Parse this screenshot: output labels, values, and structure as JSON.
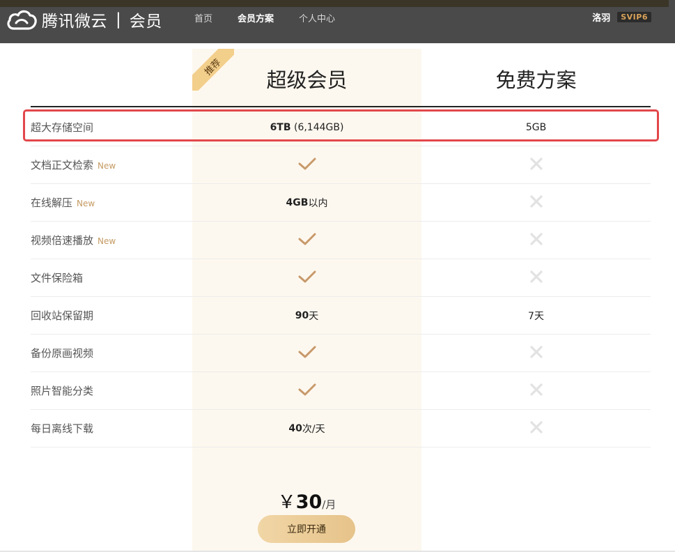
{
  "header": {
    "brand": "腾讯微云",
    "section": "会员",
    "nav": [
      {
        "label": "首页",
        "active": false
      },
      {
        "label": "会员方案",
        "active": true
      },
      {
        "label": "个人中心",
        "active": false
      }
    ],
    "user_name": "洛羽",
    "vip_level": "SVIP6"
  },
  "plans": {
    "recommend_tag": "推荐",
    "premium_title": "超级会员",
    "free_title": "免费方案"
  },
  "rows": [
    {
      "feature": "超大存储空间",
      "new": "",
      "premium_bold": "6TB",
      "premium_text": " (6,144GB)",
      "premium_icon": "",
      "free_text": "5GB",
      "free_icon": ""
    },
    {
      "feature": "文档正文检索",
      "new": "New",
      "premium_bold": "",
      "premium_text": "",
      "premium_icon": "check-icon",
      "free_text": "",
      "free_icon": "cross-icon"
    },
    {
      "feature": "在线解压",
      "new": "New",
      "premium_bold": "4GB",
      "premium_text": "以内",
      "premium_icon": "",
      "free_text": "",
      "free_icon": "cross-icon"
    },
    {
      "feature": "视频倍速播放",
      "new": "New",
      "premium_bold": "",
      "premium_text": "",
      "premium_icon": "check-icon",
      "free_text": "",
      "free_icon": "cross-icon"
    },
    {
      "feature": "文件保险箱",
      "new": "",
      "premium_bold": "",
      "premium_text": "",
      "premium_icon": "check-icon",
      "free_text": "",
      "free_icon": "cross-icon"
    },
    {
      "feature": "回收站保留期",
      "new": "",
      "premium_bold": "90",
      "premium_text": "天",
      "premium_icon": "",
      "free_text": "7天",
      "free_icon": ""
    },
    {
      "feature": "备份原画视频",
      "new": "",
      "premium_bold": "",
      "premium_text": "",
      "premium_icon": "check-icon",
      "free_text": "",
      "free_icon": "cross-icon"
    },
    {
      "feature": "照片智能分类",
      "new": "",
      "premium_bold": "",
      "premium_text": "",
      "premium_icon": "check-icon",
      "free_text": "",
      "free_icon": "cross-icon"
    },
    {
      "feature": "每日离线下载",
      "new": "",
      "premium_bold": "40",
      "premium_text": "次/天",
      "premium_icon": "",
      "free_text": "",
      "free_icon": "cross-icon"
    }
  ],
  "price": {
    "currency": "￥",
    "amount": "30",
    "unit": "/月"
  },
  "cta_label": "立即开通",
  "colors": {
    "header_bg": "#4a4a4a",
    "premium_col_bg": "#fdf8ef",
    "ribbon": "#f3cf8c",
    "check": "#c8996a",
    "cross": "#e2e2e2",
    "highlight": "#e2474b",
    "new_tag": "#c59a62"
  }
}
